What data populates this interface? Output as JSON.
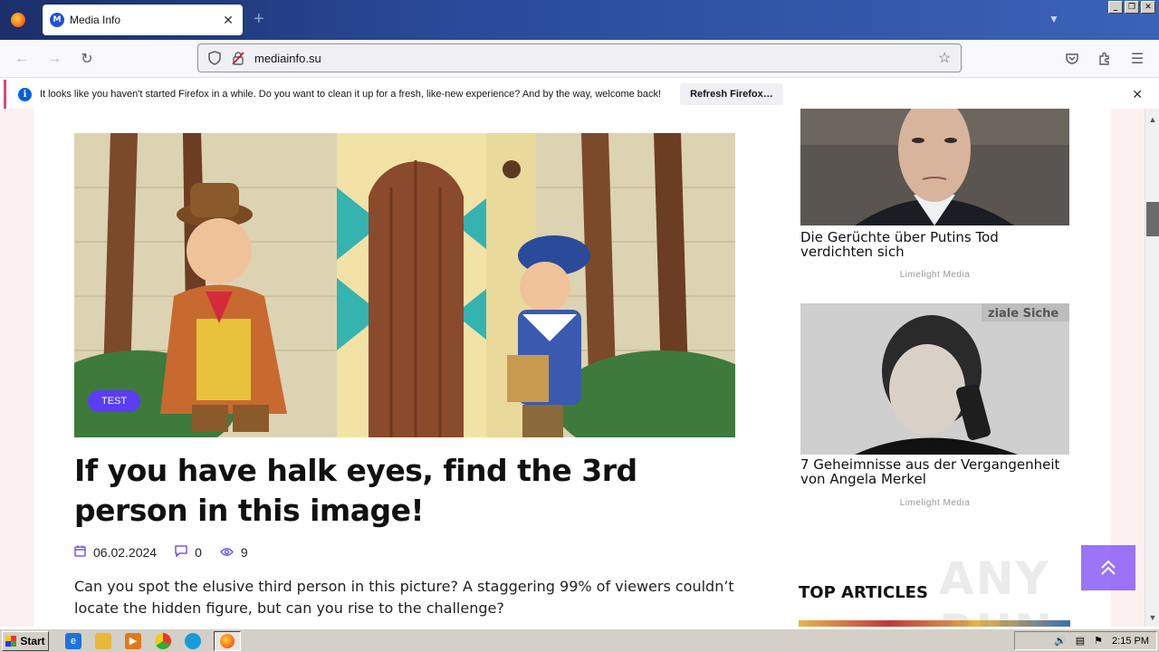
{
  "browser": {
    "tab_title": "Media Info",
    "tab_favicon_letter": "M",
    "url": "mediainfo.su",
    "new_tab_symbol": "+",
    "close_symbol": "✕"
  },
  "notification": {
    "text": "It looks like you haven't started Firefox in a while. Do you want to clean it up for a fresh, like-new experience? And by the way, welcome back!",
    "button_label": "Refresh Firefox…"
  },
  "article": {
    "badge": "TEST",
    "title": "If you have halk eyes, find the 3rd person in this image!",
    "date": "06.02.2024",
    "comments": "0",
    "views": "9",
    "excerpt": "Can you spot the elusive third person in this picture? A staggering 99% of viewers couldn’t locate the hidden figure, but can you rise to the challenge?"
  },
  "sidebar": {
    "items": [
      {
        "title": "Die Gerüchte über Putins Tod verdichten sich",
        "source": "Limelight Media"
      },
      {
        "title": "7 Geheimnisse aus der Vergangenheit von Angela Merkel",
        "source": "Limelight Media",
        "image_text": "ziale Siche"
      }
    ],
    "top_articles_heading": "TOP ARTICLES"
  },
  "watermark": "ANY RUN",
  "taskbar": {
    "start_label": "Start",
    "clock": "2:15 PM"
  },
  "colors": {
    "accent": "#5b3df5",
    "tabstrip": "#2a4a9a",
    "notification_border": "#e0467c"
  }
}
